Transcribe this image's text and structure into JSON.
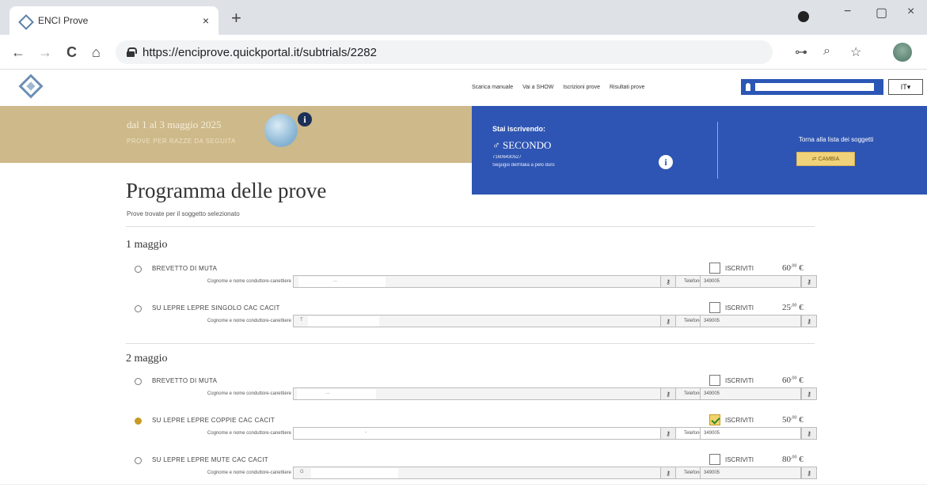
{
  "browser": {
    "tab_title": "ENCI Prove",
    "tab_close": "×",
    "new_tab": "+",
    "url": "https://enciprove.quickportal.it/subtrials/2282",
    "minimize": "−",
    "maximize": "▢",
    "close": "×"
  },
  "nav": {
    "back": "←",
    "forward": "→",
    "reload": "C",
    "home": "⌂",
    "key_icon": "⊶",
    "zoom_icon": "⌕",
    "star_icon": "☆"
  },
  "header": {
    "links": [
      "Scarica manuale",
      "Vai a SHOW",
      "Iscrizioni prove",
      "Risultati prove"
    ],
    "language": "IT▾"
  },
  "event_banner": {
    "dates": "dal 1 al 3 maggio 2025",
    "subtitle": "PROVE PER RAZZE DA SEGUITA",
    "info": "i"
  },
  "subject_banner": {
    "title": "Stai iscrivendo:",
    "name": "♂ SECONDO",
    "code": "71606430527",
    "description": "Segugio dell'Italia a pelo duro",
    "info": "i",
    "back_text": "Torna alla lista dei soggetti",
    "change_label": "⇄ CAMBIA"
  },
  "main": {
    "title": "Programma delle prove",
    "subtitle": "Prove trovate per il soggetto selezionato"
  },
  "labels": {
    "handler": "Cognome e nome conduttore-canettiere",
    "phone": "Telefono",
    "enroll": "ISCRIVITI",
    "key": "⚷",
    "currency": "€"
  },
  "days": [
    {
      "title": "1 maggio",
      "trials": [
        {
          "name": "BREVETTO DI MUTA",
          "selected": false,
          "enrolled": false,
          "price_int": "60",
          "price_dec": ",00",
          "handler_value": "...",
          "phone": "349005"
        },
        {
          "name": "SU LEPRE LEPRE SINGOLO CAC CACIT",
          "selected": false,
          "enrolled": false,
          "price_int": "25",
          "price_dec": ",00",
          "handler_value": "T",
          "phone": "349005"
        }
      ]
    },
    {
      "title": "2 maggio",
      "trials": [
        {
          "name": "BREVETTO DI MUTA",
          "selected": false,
          "enrolled": false,
          "price_int": "60",
          "price_dec": ",00",
          "handler_value": "…",
          "phone": "349005"
        },
        {
          "name": "SU LEPRE LEPRE COPPIE CAC CACIT",
          "selected": true,
          "enrolled": true,
          "price_int": "50",
          "price_dec": ",00",
          "handler_value": "-",
          "phone": "349005"
        },
        {
          "name": "SU LEPRE LEPRE MUTE CAC CACIT",
          "selected": false,
          "enrolled": false,
          "price_int": "80",
          "price_dec": ",00",
          "handler_value": "G",
          "phone": "349005"
        }
      ]
    }
  ],
  "colors": {
    "gold_banner": "#cdb98a",
    "blue_banner": "#2e55b3",
    "selected_radio": "#c79a22"
  }
}
